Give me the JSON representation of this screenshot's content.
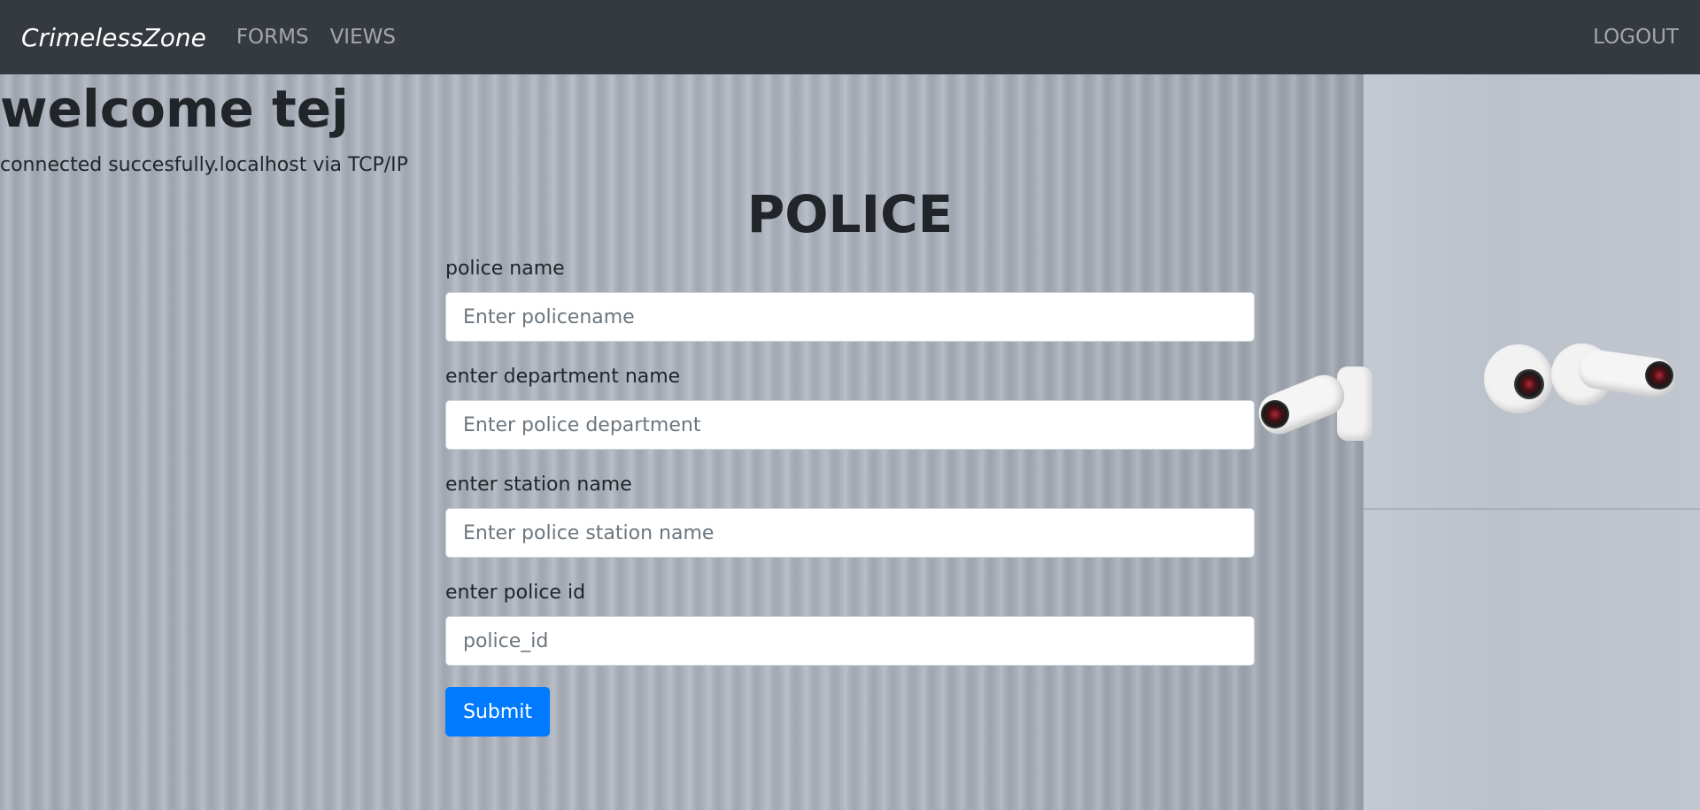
{
  "nav": {
    "brand": "CrimelessZone",
    "links": [
      "FORMS",
      "VIEWS"
    ],
    "logout": "LOGOUT"
  },
  "welcome": "welcome tej",
  "status": "connected succesfully.localhost via TCP/IP",
  "form": {
    "title": "POLICE",
    "fields": [
      {
        "label": "police name",
        "placeholder": "Enter policename",
        "value": ""
      },
      {
        "label": "enter department name",
        "placeholder": "Enter police department",
        "value": ""
      },
      {
        "label": "enter station name",
        "placeholder": "Enter police station name",
        "value": ""
      },
      {
        "label": "enter police id",
        "placeholder": "police_id",
        "value": ""
      }
    ],
    "submit": "Submit"
  },
  "colors": {
    "navbar": "#343a40",
    "primary": "#007bff",
    "text": "#212529"
  },
  "background": {
    "image": "corrugated-wall-with-security-cameras"
  }
}
